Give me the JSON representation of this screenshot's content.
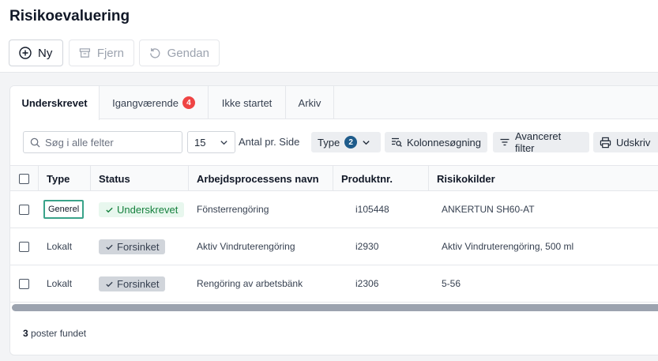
{
  "page": {
    "title": "Risikoevaluering"
  },
  "toolbar": {
    "new_label": "Ny",
    "remove_label": "Fjern",
    "restore_label": "Gendan"
  },
  "tabs": [
    {
      "label": "Underskrevet",
      "active": true
    },
    {
      "label": "Igangværende",
      "badge": "4"
    },
    {
      "label": "Ikke startet"
    },
    {
      "label": "Arkiv"
    }
  ],
  "filters": {
    "search_placeholder": "Søg i alle felter",
    "page_size": "15",
    "per_page_label": "Antal pr. Side",
    "type_label": "Type",
    "type_badge": "2",
    "column_search_label": "Kolonnesøgning",
    "advanced_filter_label": "Avanceret filter",
    "print_label": "Udskriv"
  },
  "table": {
    "columns": [
      "Type",
      "Status",
      "Arbejdsprocessens navn",
      "Produktnr.",
      "Risikokilder"
    ],
    "rows": [
      {
        "type": "Generel",
        "status": "Underskrevet",
        "process": "Fönsterrengöring",
        "product": "i105448",
        "risk": "ANKERTUN SH60-AT"
      },
      {
        "type": "Lokalt",
        "status": "Forsinket",
        "process": "Aktiv Vindruterengöring",
        "product": "i2930",
        "risk": "Aktiv Vindruterengöring, 500 ml"
      },
      {
        "type": "Lokalt",
        "status": "Forsinket",
        "process": "Rengöring av arbetsbänk",
        "product": "i2306",
        "risk": "5-56"
      }
    ]
  },
  "summary": {
    "count": "3",
    "label": "poster fundet"
  },
  "colors": {
    "accent": "#1f5c8b",
    "badge_red": "#ef4444",
    "success": "#15803d",
    "highlight": "#3aa38a"
  }
}
